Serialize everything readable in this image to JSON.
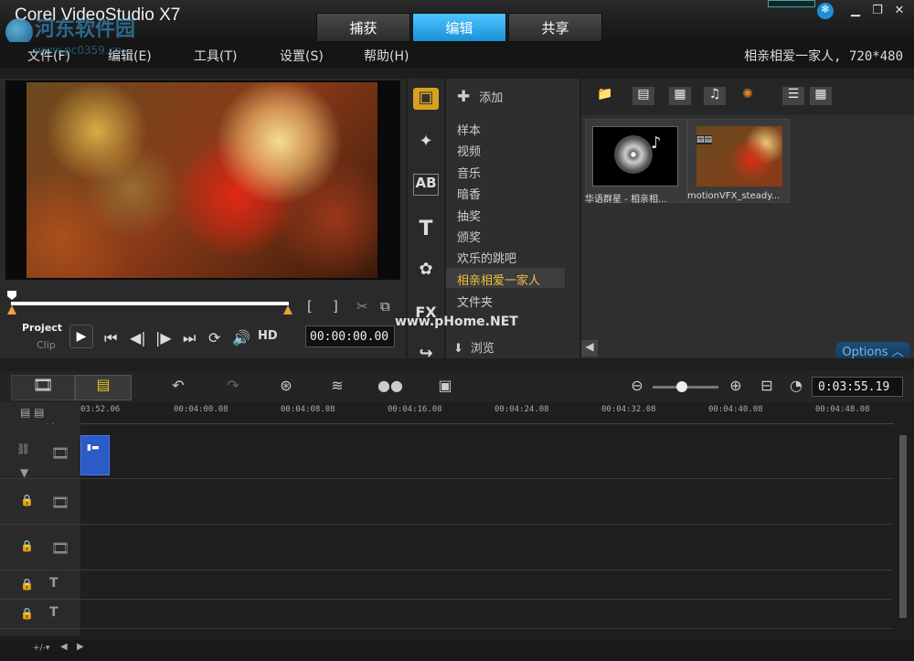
{
  "app": {
    "title": "Corel VideoStudio X7"
  },
  "tabs": [
    {
      "label": "捕获"
    },
    {
      "label": "编辑"
    },
    {
      "label": "共享"
    }
  ],
  "watermark": {
    "text": "河东软件园",
    "url": "www.pc0359.cn",
    "overlay": "www.pHome.NET"
  },
  "menu": [
    {
      "label": "文件(F)"
    },
    {
      "label": "编辑(E)"
    },
    {
      "label": "工具(T)"
    },
    {
      "label": "设置(S)"
    },
    {
      "label": "帮助(H)"
    }
  ],
  "project_info": "相亲相爱一家人, 720*480",
  "player": {
    "project_label": "Project",
    "clip_label": "Clip",
    "timecode": "00:00:00.00",
    "hd_label": "HD",
    "mark_in": "[",
    "mark_out": "]"
  },
  "library": {
    "add_label": "添加",
    "items": [
      {
        "label": "样本"
      },
      {
        "label": "视频"
      },
      {
        "label": "音乐"
      },
      {
        "label": "暗香"
      },
      {
        "label": "抽奖"
      },
      {
        "label": "颁奖"
      },
      {
        "label": "欢乐的跳吧"
      },
      {
        "label": "相亲相爱一家人"
      },
      {
        "label": "文件夹"
      }
    ],
    "selected_index": 7,
    "browse_label": "浏览",
    "options_label": "Options",
    "thumbs": [
      {
        "caption": "华语群星 - 相亲相..."
      },
      {
        "caption": "motionVFX_steady..."
      }
    ]
  },
  "timeline": {
    "duration": "0:03:55.19",
    "ruler": [
      "03:52.06",
      "00:04:00.08",
      "00:04:08.08",
      "00:04:16.08",
      "00:04:24.08",
      "00:04:32.08",
      "00:04:40.08",
      "00:04:48.08"
    ]
  },
  "colors": {
    "accent": "#1b90d8",
    "selected_text": "#f0c040"
  }
}
